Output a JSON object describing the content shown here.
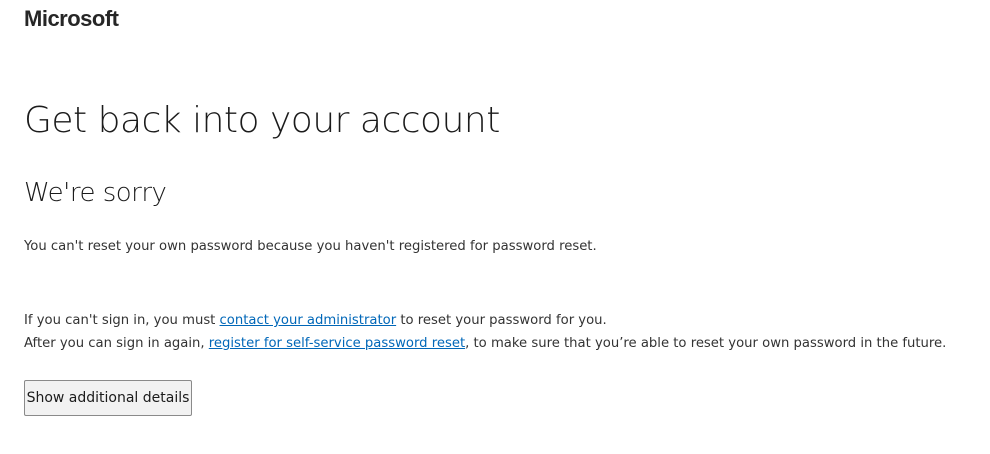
{
  "header": {
    "logo_text": "Microsoft"
  },
  "main": {
    "title": "Get back into your account",
    "subtitle": "We're sorry",
    "message": "You can't reset your own password because you haven't registered for password reset.",
    "line1": {
      "prefix": "If you can't sign in, you must ",
      "link": "contact your administrator",
      "suffix": " to reset your password for you."
    },
    "line2": {
      "prefix": "After you can sign in again, ",
      "link": "register for self-service password reset",
      "suffix": ", to make sure that you’re able to reset your own password in the future."
    },
    "details_button_label": "Show additional details"
  },
  "colors": {
    "link": "#0067b8",
    "text": "#1b1b1b",
    "button_bg": "#f2f2f2",
    "button_border": "#8a8a8a"
  }
}
